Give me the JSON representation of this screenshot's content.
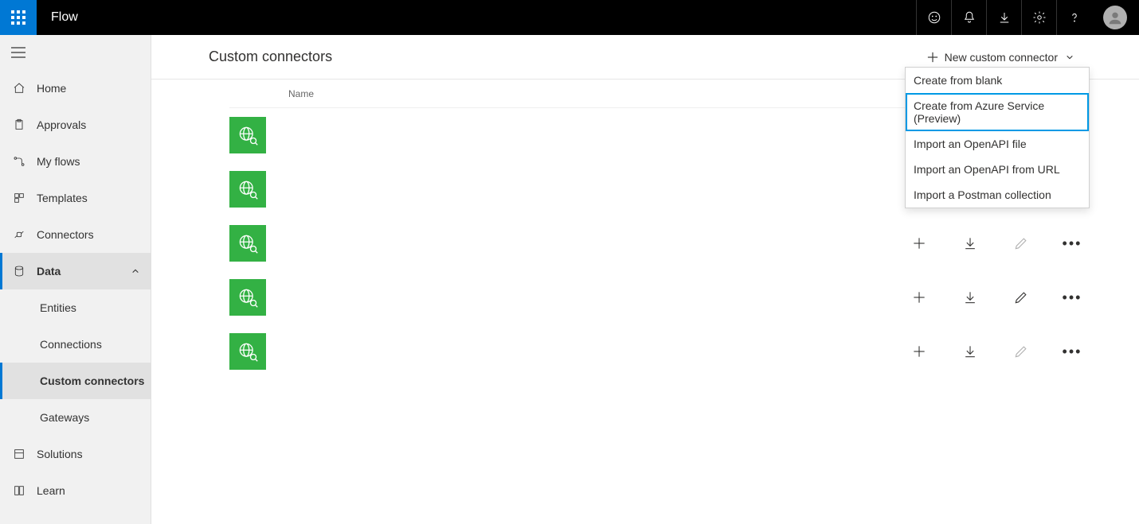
{
  "header": {
    "app_name": "Flow"
  },
  "sidebar": {
    "items": [
      {
        "label": "Home"
      },
      {
        "label": "Approvals"
      },
      {
        "label": "My flows"
      },
      {
        "label": "Templates"
      },
      {
        "label": "Connectors"
      },
      {
        "label": "Data",
        "expanded": true,
        "children": [
          {
            "label": "Entities"
          },
          {
            "label": "Connections"
          },
          {
            "label": "Custom connectors",
            "selected": true
          },
          {
            "label": "Gateways"
          }
        ]
      },
      {
        "label": "Solutions"
      },
      {
        "label": "Learn"
      }
    ]
  },
  "page": {
    "title": "Custom connectors",
    "new_button_label": "New custom connector",
    "columns": {
      "name": "Name"
    }
  },
  "dropdown": {
    "items": [
      {
        "label": "Create from blank"
      },
      {
        "label": "Create from Azure Service (Preview)",
        "highlight": true
      },
      {
        "label": "Import an OpenAPI file"
      },
      {
        "label": "Import an OpenAPI from URL"
      },
      {
        "label": "Import a Postman collection"
      }
    ]
  },
  "connectors": [
    {
      "id": 1,
      "edit_dim": true
    },
    {
      "id": 2,
      "edit_dim": true
    },
    {
      "id": 3,
      "edit_dim": true
    },
    {
      "id": 4,
      "edit_dim": false
    },
    {
      "id": 5,
      "edit_dim": true
    }
  ]
}
